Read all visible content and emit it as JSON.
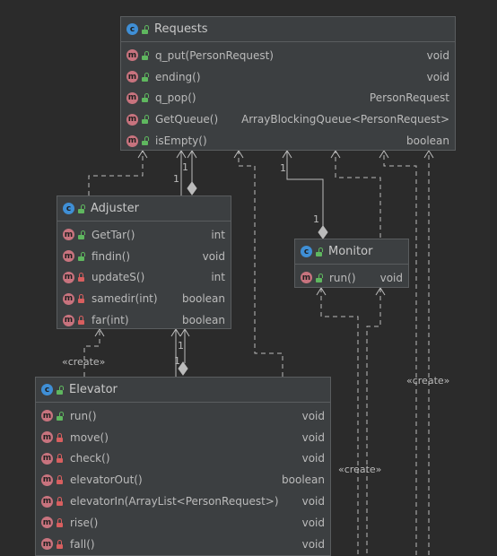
{
  "classes": {
    "requests": {
      "name": "Requests",
      "badge": "c",
      "methods": [
        {
          "name": "q_put(PersonRequest)",
          "type": "void",
          "visibility": "public"
        },
        {
          "name": "ending()",
          "type": "void",
          "visibility": "public"
        },
        {
          "name": "q_pop()",
          "type": "PersonRequest",
          "visibility": "public"
        },
        {
          "name": "GetQueue()",
          "type": "ArrayBlockingQueue<PersonRequest>",
          "visibility": "public"
        },
        {
          "name": "isEmpty()",
          "type": "boolean",
          "visibility": "public"
        }
      ]
    },
    "adjuster": {
      "name": "Adjuster",
      "badge": "c",
      "methods": [
        {
          "name": "GetTar()",
          "type": "int",
          "visibility": "public"
        },
        {
          "name": "findin()",
          "type": "void",
          "visibility": "public"
        },
        {
          "name": "updateS()",
          "type": "int",
          "visibility": "private"
        },
        {
          "name": "samedir(int)",
          "type": "boolean",
          "visibility": "private"
        },
        {
          "name": "far(int)",
          "type": "boolean",
          "visibility": "private"
        }
      ]
    },
    "monitor": {
      "name": "Monitor",
      "badge": "c",
      "methods": [
        {
          "name": "run()",
          "type": "void",
          "visibility": "public"
        }
      ]
    },
    "elevator": {
      "name": "Elevator",
      "badge": "c",
      "methods": [
        {
          "name": "run()",
          "type": "void",
          "visibility": "public"
        },
        {
          "name": "move()",
          "type": "void",
          "visibility": "private"
        },
        {
          "name": "check()",
          "type": "void",
          "visibility": "private"
        },
        {
          "name": "elevatorOut()",
          "type": "boolean",
          "visibility": "private"
        },
        {
          "name": "elevatorIn(ArrayList<PersonRequest>)",
          "type": "void",
          "visibility": "private"
        },
        {
          "name": "rise()",
          "type": "void",
          "visibility": "private"
        },
        {
          "name": "fall()",
          "type": "void",
          "visibility": "private"
        }
      ]
    }
  },
  "edge_labels": {
    "create_adjuster": "«create»",
    "create_monitor": "«create»",
    "create_right": "«create»",
    "mult_requests_adjuster": "1",
    "mult_adjuster_side": "1",
    "mult_requests_monitor": "1",
    "mult_monitor_side": "1",
    "mult_adjuster_elevator": "1",
    "mult_elevator_side": "1"
  },
  "colors": {
    "background": "#2b2b2b",
    "class_bg": "#3c3f41",
    "class_badge": "#3f8fd6",
    "method_badge": "#c8737e",
    "public": "#5fb75f",
    "private": "#d75f5f",
    "edge": "#bbbbbb"
  }
}
